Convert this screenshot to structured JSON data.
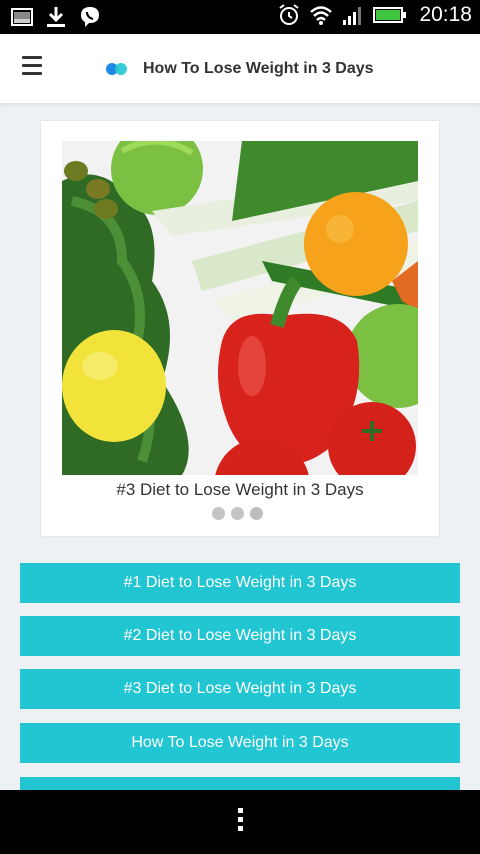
{
  "status_bar": {
    "time": "20:18",
    "left_icons": [
      "image-icon",
      "download-icon",
      "viber-icon"
    ],
    "right_icons": [
      "alarm-icon",
      "wifi-icon",
      "signal-icon",
      "battery-icon"
    ]
  },
  "app_bar": {
    "title": "How To Lose Weight in 3 Days",
    "menu_icon": "hamburger-menu-icon",
    "logo_icon": "app-logo-icon"
  },
  "slider": {
    "caption": "#3 Diet to Lose Weight in 3 Days",
    "dots_count": 3,
    "next_icon": "chevron-right-icon"
  },
  "buttons": [
    {
      "label": "#1 Diet to Lose Weight in 3 Days"
    },
    {
      "label": "#2 Diet to Lose Weight in 3 Days"
    },
    {
      "label": "#3 Diet to Lose Weight in 3 Days"
    },
    {
      "label": "How To Lose Weight in 3 Days"
    },
    {
      "label": ""
    }
  ],
  "colors": {
    "accent": "#22c6d2",
    "background": "#eef1f4",
    "logo_blue": "#1e88e5",
    "logo_teal": "#22c6d2"
  }
}
